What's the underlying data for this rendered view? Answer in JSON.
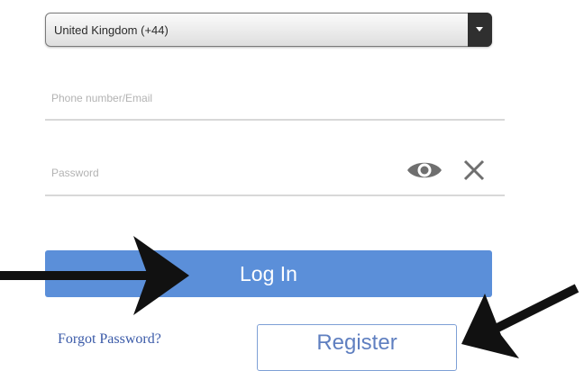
{
  "country_select": {
    "value": "United Kingdom (+44)"
  },
  "phone_field": {
    "placeholder": "Phone number/Email"
  },
  "password_field": {
    "placeholder": "Password"
  },
  "icons": {
    "toggle_visibility": "eye-icon",
    "clear": "close-icon"
  },
  "login": {
    "label": "Log In"
  },
  "forgot": {
    "label": "Forgot Password?"
  },
  "register": {
    "label": "Register"
  },
  "colors": {
    "primary_button": "#5b8fd9",
    "link": "#3a5aa8",
    "register_border": "#7ea0d6",
    "annotation_arrow": "#111111"
  }
}
